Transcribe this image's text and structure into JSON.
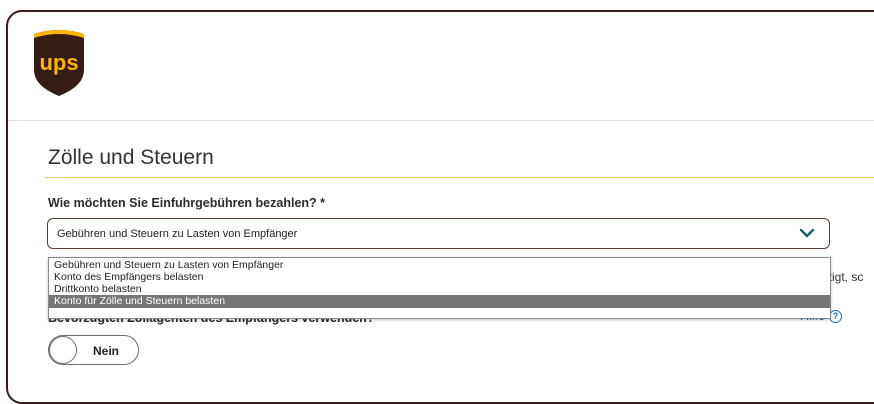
{
  "brand": {
    "logo_text": "ups",
    "logo_colors": {
      "shield": "#351c15",
      "gold": "#ffb500"
    }
  },
  "section": {
    "title": "Zölle und Steuern"
  },
  "payment": {
    "question": "Wie möchten Sie Einfuhrgebühren bezahlen? *",
    "selected_value": "Gebühren und Steuern zu Lasten von Empfänger",
    "options": [
      "Gebühren und Steuern zu Lasten von Empfänger",
      "Konto des Empfängers belasten",
      "Drittkonto belasten",
      "Konto für Zölle und Steuern belasten"
    ],
    "highlighted_option_index": 3
  },
  "partially_hidden": {
    "right_text": "ntigt, sc",
    "question": "Bevorzugten Zollagenten des Empfängers verwenden?"
  },
  "help": {
    "label": "Hilfe",
    "icon": "question-circle-icon"
  },
  "toggle": {
    "label": "Nein",
    "state": "off"
  },
  "colors": {
    "accent_rule": "#e9c46a",
    "link": "#1b6fc9",
    "selected_option_bg": "#767676"
  }
}
